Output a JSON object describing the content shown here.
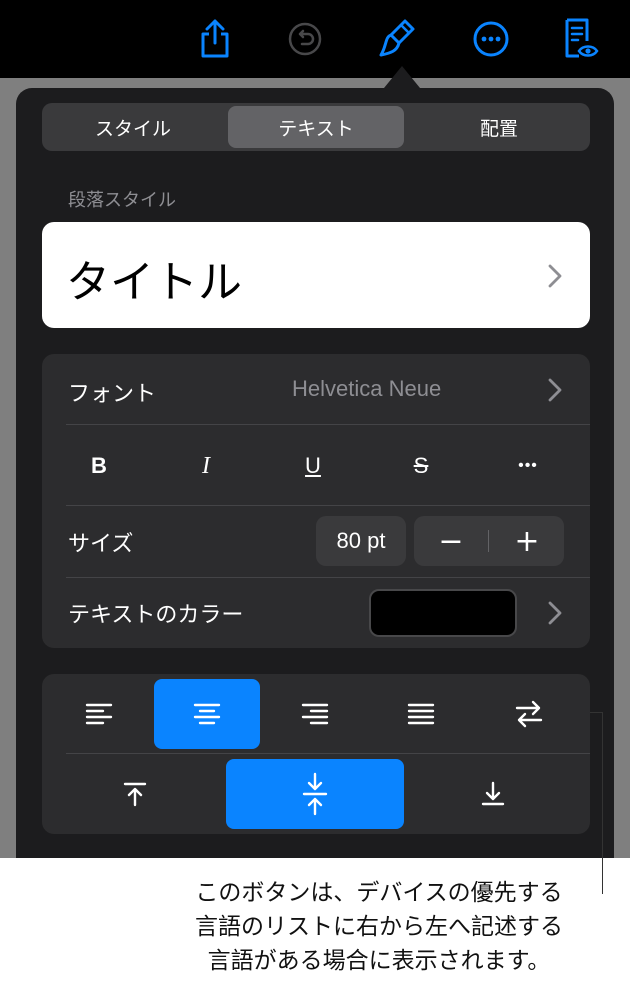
{
  "toolbar": {
    "share_icon": "share-icon",
    "undo_icon": "undo-icon",
    "format_icon": "format-brush-icon",
    "more_icon": "more-icon",
    "reader_icon": "reader-view-icon",
    "accent_color": "#0a84ff"
  },
  "tabs": [
    {
      "label": "スタイル",
      "selected": false
    },
    {
      "label": "テキスト",
      "selected": true
    },
    {
      "label": "配置",
      "selected": false
    }
  ],
  "paragraph_style": {
    "section_label": "段落スタイル",
    "value": "タイトル"
  },
  "font": {
    "label": "フォント",
    "value": "Helvetica Neue"
  },
  "format_buttons": {
    "bold": "B",
    "italic": "I",
    "underline": "U",
    "strikethrough": "S",
    "more": "•••"
  },
  "size": {
    "label": "サイズ",
    "value": "80 pt",
    "decrement": "−",
    "increment": "+"
  },
  "text_color": {
    "label": "テキストのカラー",
    "color": "#000000"
  },
  "alignment": {
    "horizontal": [
      "left",
      "center",
      "right",
      "justify",
      "right-to-left"
    ],
    "horizontal_selected": "center",
    "vertical": [
      "top",
      "middle",
      "bottom"
    ],
    "vertical_selected": "middle"
  },
  "callout": {
    "lines": [
      "このボタンは、デバイスの優先する",
      "言語のリストに右から左へ記述する",
      "言語がある場合に表示されます。"
    ]
  }
}
